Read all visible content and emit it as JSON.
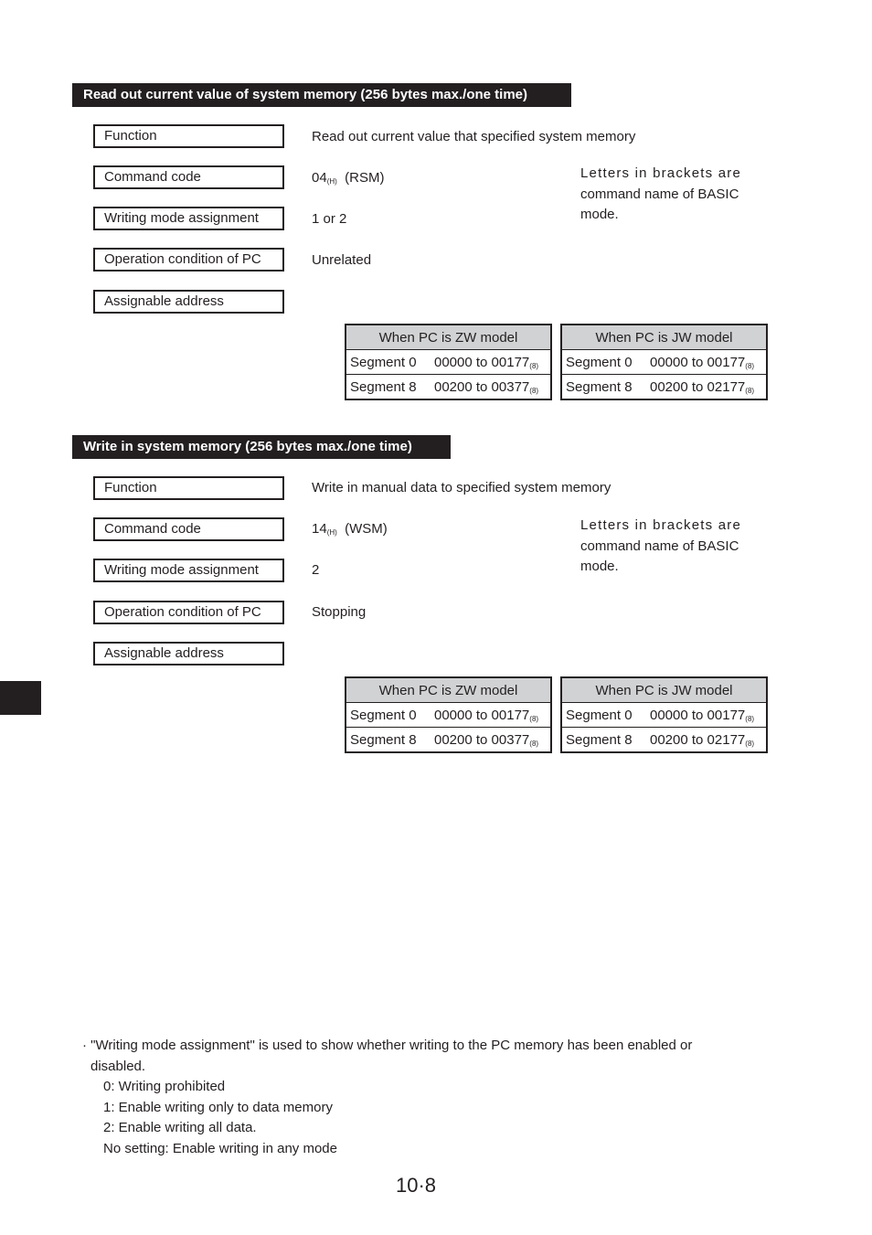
{
  "sections": [
    {
      "heading": "Read out current value of system memory (256 bytes max./one time)",
      "rows": [
        {
          "label": "Function",
          "value": "Read out current value that specified system memory"
        },
        {
          "label": "Command code",
          "value_main": "04",
          "value_sub": "(H)",
          "value_suffix": "(RSM)"
        },
        {
          "label": "Writing mode assignment",
          "value": "1 or 2"
        },
        {
          "label": "Operation condition of PC",
          "value": "Unrelated"
        },
        {
          "label": "Assignable address",
          "value": ""
        }
      ],
      "note": {
        "line1": "Letters in brackets are",
        "line2": "command name of BASIC",
        "line3": "mode."
      },
      "tables": [
        {
          "header": "When PC is ZW model",
          "rows": [
            {
              "segment": "Segment 0",
              "range": "00000 to 00177",
              "base": "(8)"
            },
            {
              "segment": "Segment 8",
              "range": "00200 to 00377",
              "base": "(8)"
            }
          ]
        },
        {
          "header": "When PC is JW model",
          "rows": [
            {
              "segment": "Segment 0",
              "range": "00000 to 00177",
              "base": "(8)"
            },
            {
              "segment": "Segment 8",
              "range": "00200 to 02177",
              "base": "(8)"
            }
          ]
        }
      ]
    },
    {
      "heading": "Write in system memory (256 bytes max./one time)",
      "rows": [
        {
          "label": "Function",
          "value": "Write in manual data to specified system memory"
        },
        {
          "label": "Command code",
          "value_main": "14",
          "value_sub": "(H)",
          "value_suffix": "(WSM)"
        },
        {
          "label": "Writing mode assignment",
          "value": "2"
        },
        {
          "label": "Operation condition of PC",
          "value": "Stopping"
        },
        {
          "label": "Assignable address",
          "value": ""
        }
      ],
      "note": {
        "line1": "Letters in brackets are",
        "line2": "command name of BASIC",
        "line3": "mode."
      },
      "tables": [
        {
          "header": "When PC is ZW model",
          "rows": [
            {
              "segment": "Segment 0",
              "range": "00000 to 00177",
              "base": "(8)"
            },
            {
              "segment": "Segment 8",
              "range": "00200 to 00377",
              "base": "(8)"
            }
          ]
        },
        {
          "header": "When PC is JW model",
          "rows": [
            {
              "segment": "Segment 0",
              "range": "00000 to 00177",
              "base": "(8)"
            },
            {
              "segment": "Segment 8",
              "range": "00200 to 02177",
              "base": "(8)"
            }
          ]
        }
      ]
    }
  ],
  "footnote": {
    "line1": "· \"Writing mode assignment\" is used to show whether writing to the PC memory has been enabled or",
    "line2": "disabled.",
    "items": [
      "0: Writing prohibited",
      "1: Enable writing only to data memory",
      "2: Enable writing all data.",
      "No setting: Enable writing in any mode"
    ]
  },
  "page_number": "10·8",
  "colors": {
    "ink": "#231f20",
    "table_header": "#d1d2d4"
  }
}
